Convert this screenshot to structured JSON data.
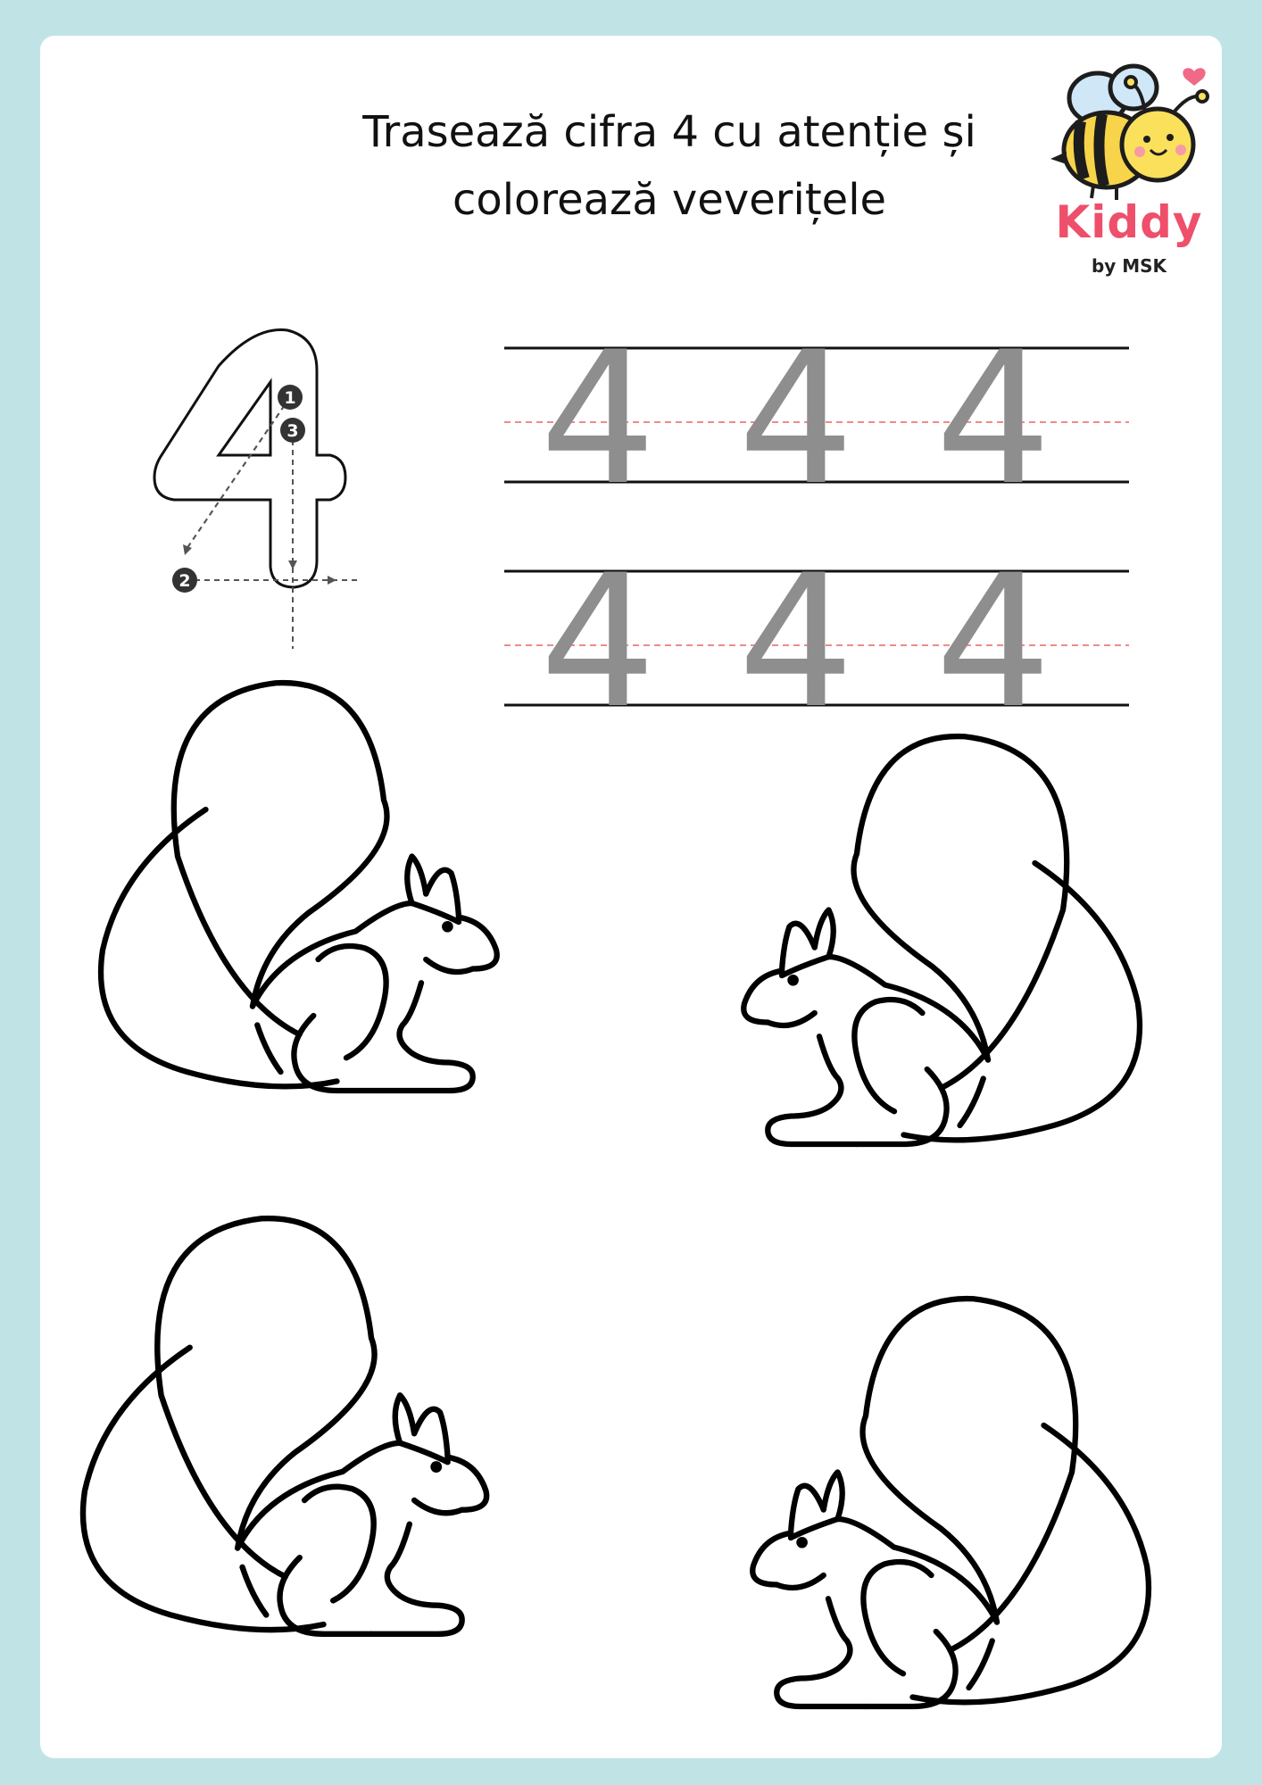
{
  "title": {
    "line1": "Trasează cifra 4 cu atenție și",
    "line2": "colorează veverițele"
  },
  "logo": {
    "name": "Kiddy",
    "byline": "by MSK",
    "icon": "bee-icon",
    "accent_color": "#ee4f6a"
  },
  "tracing_guide": {
    "digit": "4",
    "step_numbers": [
      "1",
      "2",
      "3"
    ]
  },
  "practice_rows": [
    {
      "digits": [
        "4",
        "4",
        "4"
      ]
    },
    {
      "digits": [
        "4",
        "4",
        "4"
      ]
    }
  ],
  "colors": {
    "background": "#c0e3e6",
    "sheet": "#ffffff",
    "trace_digit": "#8e8e8e",
    "midline": "#f08a8a"
  }
}
